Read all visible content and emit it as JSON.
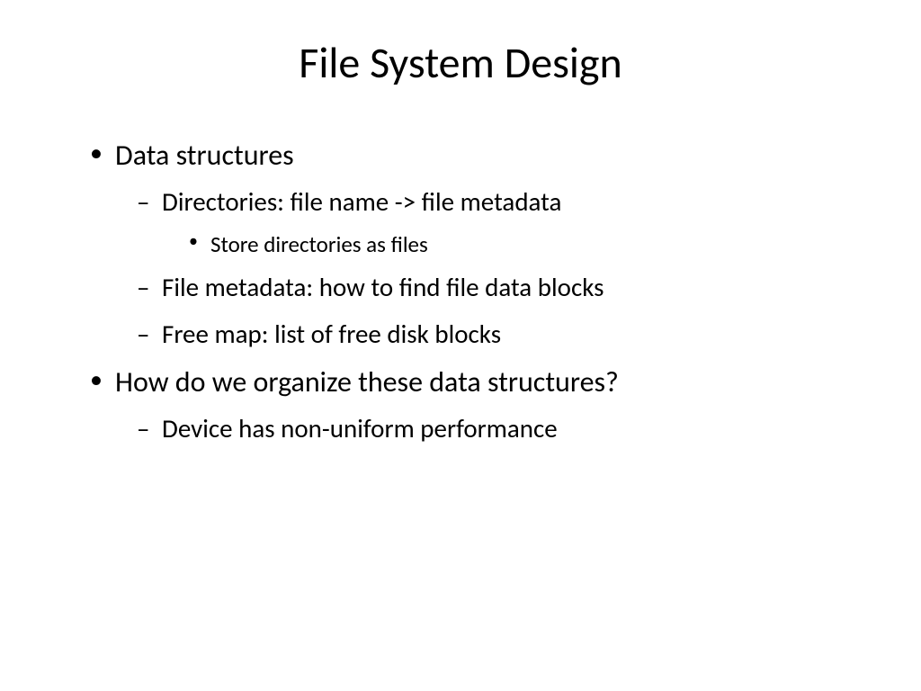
{
  "slide": {
    "title": "File System Design",
    "bullets": {
      "item1": "Data structures",
      "item1_sub1": "Directories: file name -> file metadata",
      "item1_sub1_sub1": "Store directories as files",
      "item1_sub2": "File metadata: how to find file data blocks",
      "item1_sub3": "Free map: list of free disk blocks",
      "item2": "How do we organize these data structures?",
      "item2_sub1": "Device has non-uniform performance"
    }
  }
}
